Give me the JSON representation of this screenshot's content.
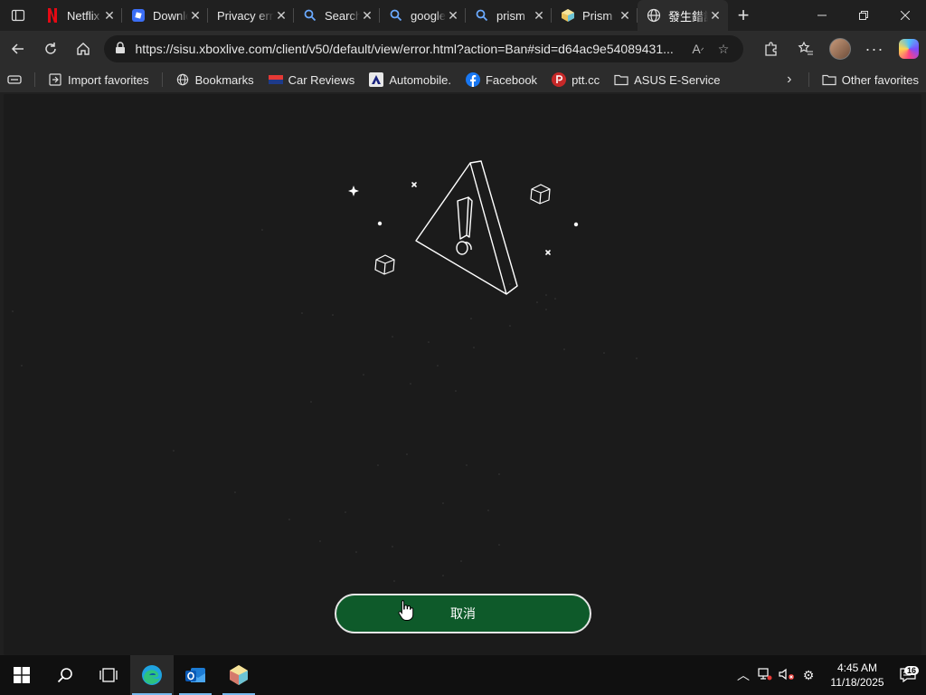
{
  "browser": {
    "tabs": [
      {
        "label": "Netflix",
        "icon": "netflix-icon",
        "active": false
      },
      {
        "label": "Download",
        "icon": "roblox-icon",
        "active": false
      },
      {
        "label": "Privacy error",
        "icon": "none",
        "active": false
      },
      {
        "label": "Search",
        "icon": "search-icon",
        "active": false
      },
      {
        "label": "google",
        "icon": "search-icon",
        "active": false
      },
      {
        "label": "prism",
        "icon": "search-icon",
        "active": false
      },
      {
        "label": "Prism",
        "icon": "prism-icon",
        "active": false
      },
      {
        "label": "發生錯誤",
        "icon": "globe-icon",
        "active": true
      }
    ],
    "close_glyph": "✕",
    "new_tab_glyph": "+",
    "url": "https://sisu.xboxlive.com/client/v50/default/view/error.html?action=Ban#sid=d64ac9e54089431...",
    "favorites": [
      {
        "label": "Import favorites",
        "icon": "import-icon"
      },
      {
        "label": "Bookmarks",
        "icon": "globe-icon"
      },
      {
        "label": "Car Reviews",
        "icon": "car-reviews-icon"
      },
      {
        "label": "Automobile.",
        "icon": "automobile-icon"
      },
      {
        "label": "Facebook",
        "icon": "facebook-icon"
      },
      {
        "label": "ptt.cc",
        "icon": "ptt-icon"
      },
      {
        "label": "ASUS E-Service",
        "icon": "folder-icon"
      }
    ],
    "other_favorites": "Other favorites"
  },
  "page": {
    "cancel_button_label": "取消"
  },
  "taskbar": {
    "time": "4:45 AM",
    "date": "11/18/2025",
    "notification_count": "16"
  },
  "colors": {
    "page_background": "#1b1b1b",
    "button_green": "#0e5a2a",
    "chrome_dark": "#202020",
    "toolbar": "#2c2c2c"
  }
}
